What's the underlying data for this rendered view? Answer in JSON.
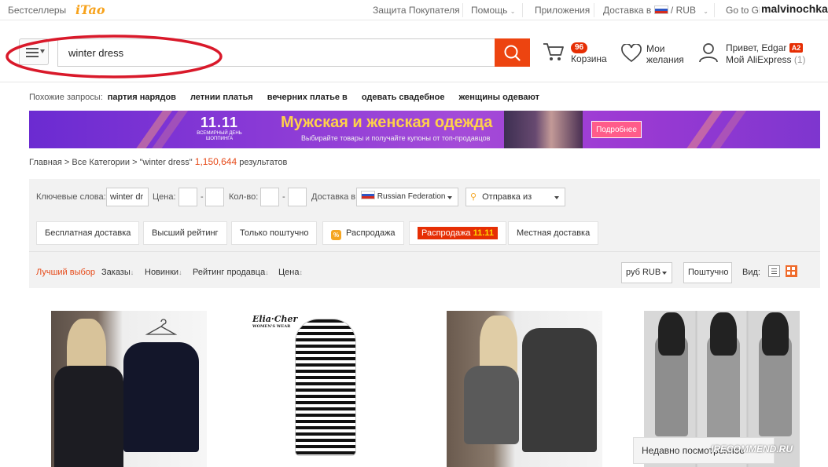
{
  "topbar": {
    "bestsellers": "Бестселлеры",
    "itao_logo": "iTao",
    "buyer_protection": "Защита Покупателя",
    "help": "Помощь",
    "apps": "Приложения",
    "delivery_label": "Доставка в",
    "currency": "RUB",
    "go_to": "Go to Gl",
    "username_overlay": "malvinochka"
  },
  "header": {
    "search_value": "winter dress",
    "cart_label": "Корзина",
    "cart_count": "96",
    "wishlist_line1": "Мои",
    "wishlist_line2": "желания",
    "greeting": "Привет, Edgar",
    "level_badge": "A2",
    "my_account": "Мой AliExpress",
    "account_count": "(1)"
  },
  "related": {
    "label": "Похожие запросы:",
    "items": [
      "партия нарядов",
      "летнии платья",
      "вечерних платье в",
      "одевать свадебное",
      "женщины одевают"
    ]
  },
  "banner": {
    "logo_big": "11.11",
    "logo_small1": "ВСЕМИРНЫЙ ДЕНЬ",
    "logo_small2": "ШОППИНГА",
    "title": "Мужская и женская одежда",
    "subtitle": "Выбирайте товары и получайте купоны от топ-продавцов",
    "button": "Подробнее"
  },
  "breadcrumb": {
    "home": "Главная",
    "all_categories": "Все Категории",
    "query": "\"winter dress\"",
    "count": "1,150,644",
    "results": "результатов"
  },
  "filters": {
    "keywords_label": "Ключевые слова:",
    "keywords_value": "winter dr",
    "price_label": "Цена:",
    "qty_label": "Кол-во:",
    "dash": "-",
    "ship_to_label": "Доставка в",
    "ship_to_value": "Russian Federation",
    "ship_from": "Отправка из",
    "chips": [
      "Бесплатная доставка",
      "Высший рейтинг",
      "Только поштучно",
      "Распродажа",
      "Местная доставка"
    ],
    "sale_chip_text": "Распродажа",
    "sale_chip_num": "11.11",
    "pct_icon": "%"
  },
  "sort": {
    "best": "Лучший выбор",
    "orders": "Заказы",
    "new": "Новинки",
    "seller_rating": "Рейтинг продавца",
    "price": "Цена",
    "currency_select": "руб RUB",
    "per_piece": "Поштучно",
    "view_label": "Вид:"
  },
  "products": {
    "brand_label": "Elia·Cher",
    "brand_sub": "WOMEN'S WEAR"
  },
  "recent": {
    "label": "Недавно посмотренное"
  },
  "watermark": "IRECOMMEND.RU",
  "colors": {
    "accent": "#ed4410",
    "sale": "#e62e04",
    "count": "#e64a19",
    "annotation": "#d9192a"
  }
}
